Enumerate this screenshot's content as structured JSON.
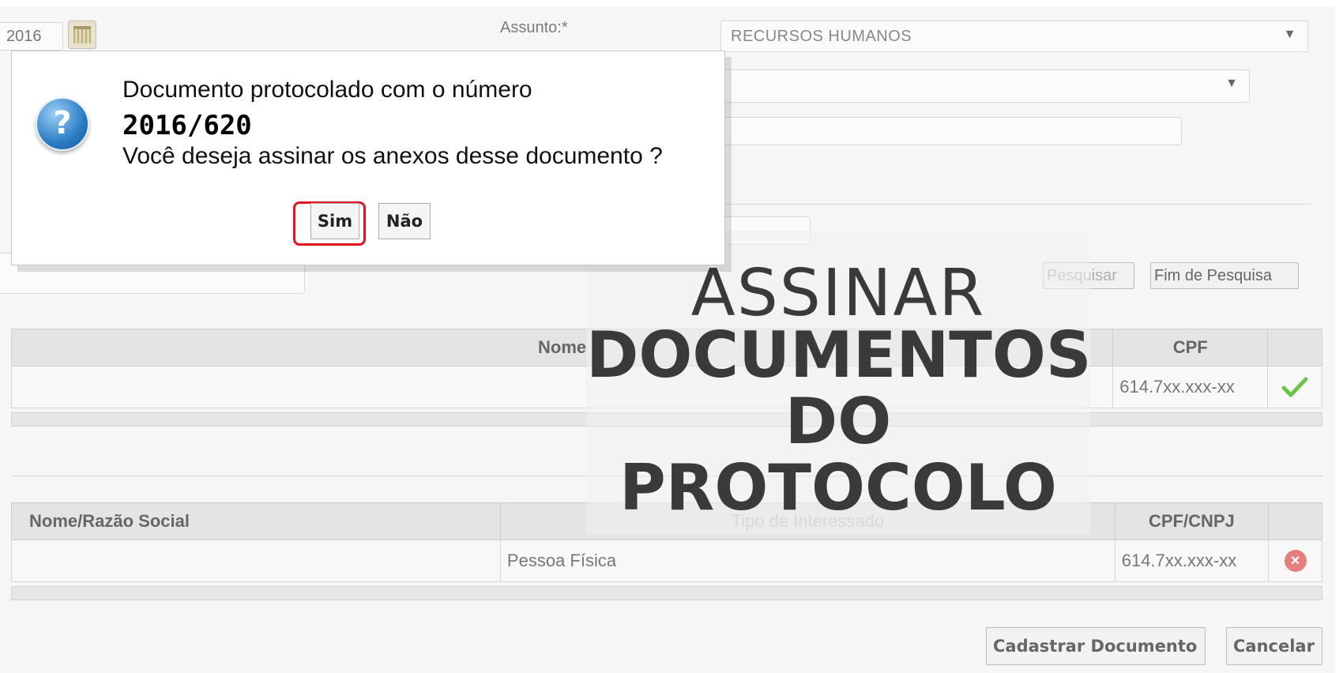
{
  "form": {
    "date_value": "2016",
    "assunto_label": "Assunto:*",
    "assunto_value": "RECURSOS HUMANOS",
    "pesquisar_label": "Pesquisar",
    "fim_pesquisa_label": "Fim de Pesquisa"
  },
  "table1": {
    "headers": [
      "Nome",
      "CPF"
    ],
    "rows": [
      {
        "nome": "",
        "cpf": "614.7xx.xxx-xx"
      }
    ]
  },
  "table2": {
    "headers": [
      "Nome/Razão Social",
      "Tipo de Interessado",
      "CPF/CNPJ"
    ],
    "rows": [
      {
        "nome": "",
        "tipo": "Pessoa Física",
        "cpf": "614.7xx.xxx-xx"
      }
    ]
  },
  "actions": {
    "cadastrar_label": "Cadastrar Documento",
    "cancelar_label": "Cancelar"
  },
  "dialog": {
    "line1": "Documento protocolado com o número",
    "number": "2016/620",
    "question": "Você deseja assinar os anexos desse documento ?",
    "yes_label": "Sim",
    "no_label": "Não"
  },
  "overlay": {
    "line1": "ASSINAR",
    "line2": "DOCUMENTOS",
    "line3": "DO",
    "line4": "PROTOCOLO"
  },
  "colors": {
    "highlight": "#e0141e",
    "check": "#6cc24a",
    "remove": "#e57f7f"
  }
}
